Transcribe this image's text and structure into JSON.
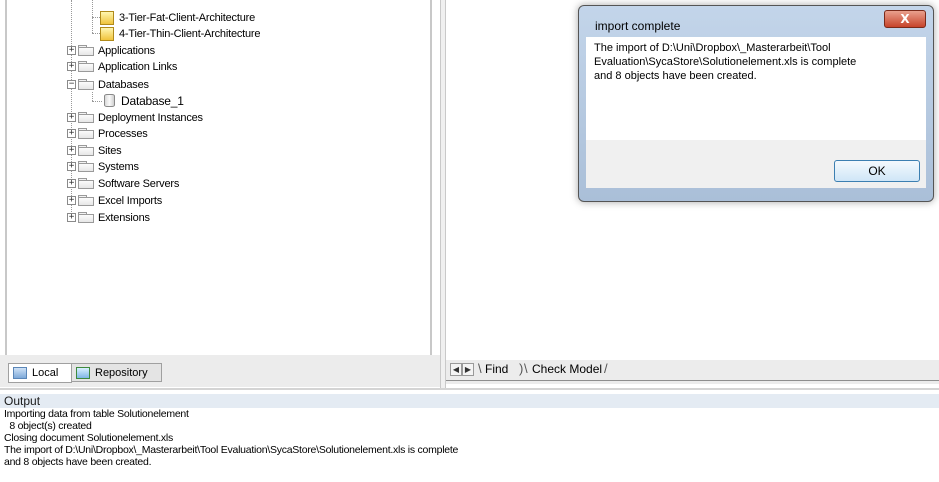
{
  "tree": {
    "items": [
      {
        "label": "3-Tier-Fat-Client-Architecture",
        "icon": "yellow-box-icon"
      },
      {
        "label": "4-Tier-Thin-Client-Architecture",
        "icon": "yellow-box-icon"
      },
      {
        "label": "Applications",
        "expander": "+"
      },
      {
        "label": "Application Links",
        "expander": "+"
      },
      {
        "label": "Databases",
        "expander": "−"
      },
      {
        "label": "Database_1",
        "icon": "database-icon"
      },
      {
        "label": "Deployment Instances",
        "expander": "+"
      },
      {
        "label": "Processes",
        "expander": "+"
      },
      {
        "label": "Sites",
        "expander": "+"
      },
      {
        "label": "Systems",
        "expander": "+"
      },
      {
        "label": "Software Servers",
        "expander": "+"
      },
      {
        "label": "Excel Imports",
        "expander": "+"
      },
      {
        "label": "Extensions",
        "expander": "+"
      }
    ]
  },
  "left_tabs": {
    "local": "Local",
    "repository": "Repository"
  },
  "right_tabs": {
    "find": "Find",
    "check_model": "Check Model"
  },
  "output": {
    "title": "Output",
    "lines": [
      "Importing data from table Solutionelement",
      "  8 object(s) created",
      "Closing document Solutionelement.xls",
      "The import of D:\\Uni\\Dropbox\\_Masterarbeit\\Tool Evaluation\\SycaStore\\Solutionelement.xls is complete",
      "and 8 objects have been created."
    ]
  },
  "dialog": {
    "title": "import complete",
    "close": "X",
    "message": [
      "The import of D:\\Uni\\Dropbox\\_Masterarbeit\\Tool",
      "Evaluation\\SycaStore\\Solutionelement.xls is complete",
      "and 8 objects have been created."
    ],
    "ok": "OK"
  }
}
